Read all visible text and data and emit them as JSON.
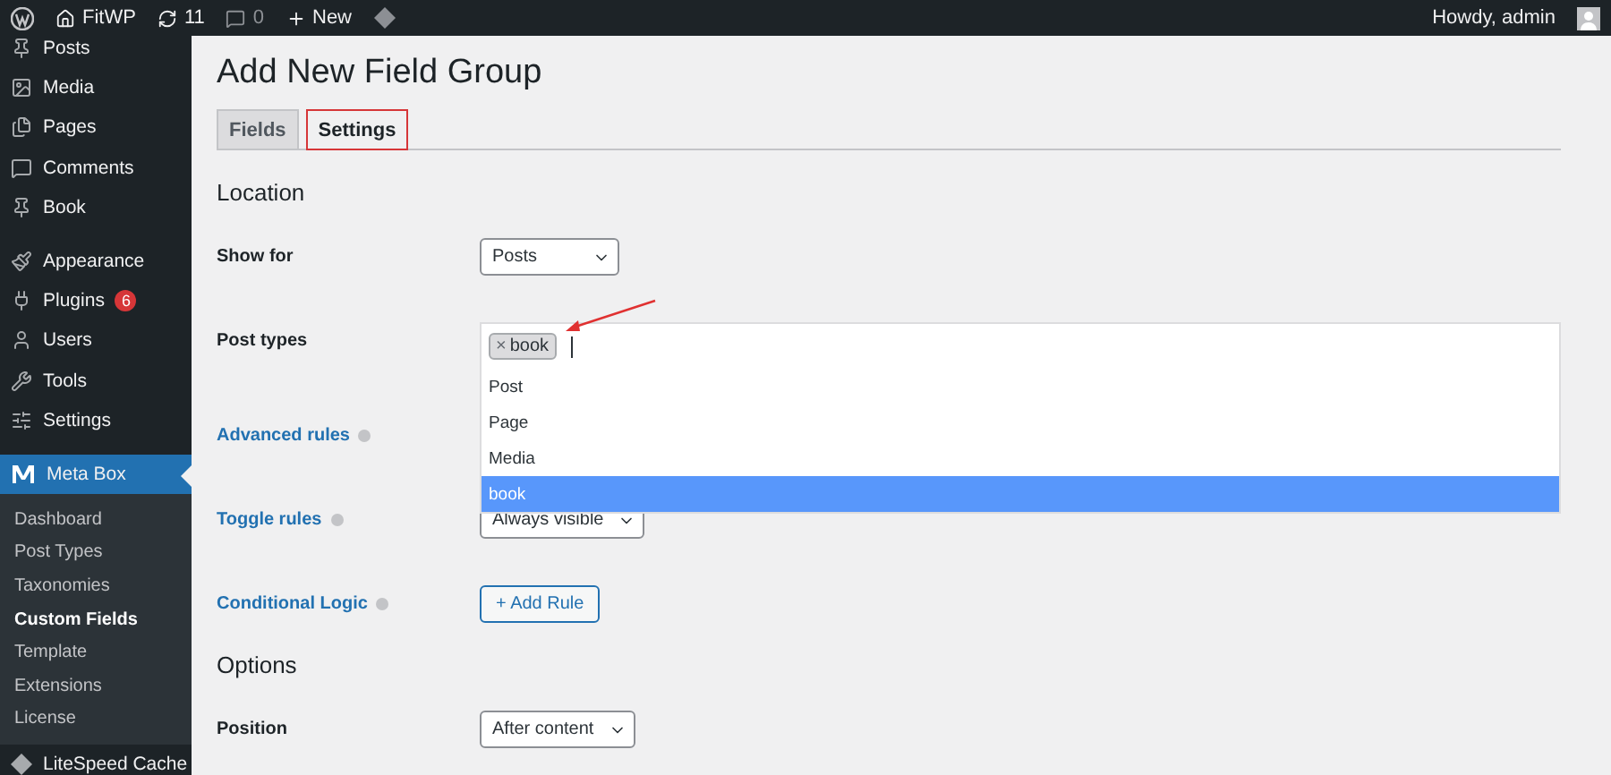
{
  "admin_bar": {
    "site": "FitWP",
    "updates": "11",
    "comments": "0",
    "new": "New",
    "greeting": "Howdy, admin"
  },
  "sidebar": {
    "items": [
      {
        "label": "Posts",
        "selected": false
      },
      {
        "label": "Media",
        "selected": false
      },
      {
        "label": "Pages",
        "selected": false
      },
      {
        "label": "Comments",
        "selected": false
      },
      {
        "label": "Book",
        "selected": false
      },
      {
        "label": "Appearance",
        "selected": false
      },
      {
        "label": "Plugins",
        "selected": false,
        "badge": "6"
      },
      {
        "label": "Users",
        "selected": false
      },
      {
        "label": "Tools",
        "selected": false
      },
      {
        "label": "Settings",
        "selected": false
      },
      {
        "label": "Meta Box",
        "selected": true,
        "children": [
          {
            "label": "Dashboard",
            "selected": false
          },
          {
            "label": "Post Types",
            "selected": false
          },
          {
            "label": "Taxonomies",
            "selected": false
          },
          {
            "label": "Custom Fields",
            "selected": true
          },
          {
            "label": "Template",
            "selected": false
          },
          {
            "label": "Extensions",
            "selected": false
          },
          {
            "label": "License",
            "selected": false
          }
        ]
      },
      {
        "label": "LiteSpeed Cache",
        "selected": false
      }
    ]
  },
  "page": {
    "title": "Add New Field Group",
    "tabs": [
      {
        "label": "Fields",
        "selected": false,
        "highlighted": false
      },
      {
        "label": "Settings",
        "selected": true,
        "highlighted": true
      }
    ],
    "sections": [
      {
        "heading": "Location",
        "rows": [
          {
            "label": "Show for",
            "help": false,
            "control": {
              "kind": "select",
              "value": "Posts"
            }
          },
          {
            "label": "Post types",
            "help": false,
            "control": {
              "kind": "tags",
              "tags": [
                {
                  "remove": "×",
                  "label": "book"
                }
              ],
              "options": [
                {
                  "label": "Post",
                  "selected": false
                },
                {
                  "label": "Page",
                  "selected": false
                },
                {
                  "label": "Media",
                  "selected": false
                },
                {
                  "label": "book",
                  "selected": true
                }
              ]
            }
          },
          {
            "label": "Advanced rules",
            "help": true
          },
          {
            "label": "Toggle rules",
            "help": true,
            "control": {
              "kind": "select",
              "value": "Always visible"
            }
          },
          {
            "label": "Conditional Logic",
            "help": true,
            "control": {
              "kind": "button",
              "label": "+ Add Rule"
            }
          }
        ]
      },
      {
        "heading": "Options",
        "rows": [
          {
            "label": "Position",
            "help": false,
            "control": {
              "kind": "select",
              "value": "After content"
            }
          }
        ]
      }
    ]
  }
}
